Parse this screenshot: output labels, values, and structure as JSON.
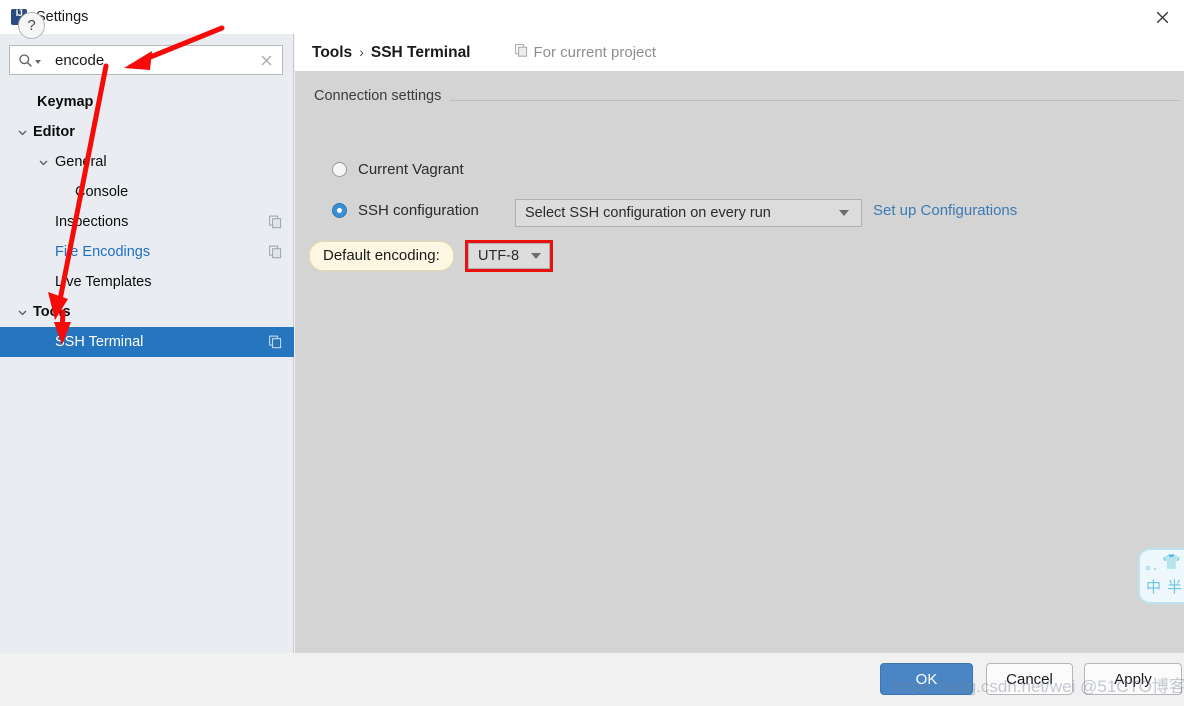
{
  "window": {
    "title": "Settings",
    "app_icon": "intellij-idea-icon",
    "close_label": "×"
  },
  "search": {
    "value": "encode",
    "placeholder": "",
    "icon": "search-icon",
    "clear_icon": "clear-icon"
  },
  "sidebar": {
    "items": [
      {
        "label": "Keymap",
        "indent": 37,
        "bold": true,
        "twisty": "",
        "link": false,
        "copy": false,
        "selected": false
      },
      {
        "label": "Editor",
        "indent": 33,
        "bold": true,
        "twisty": "down",
        "link": false,
        "copy": false,
        "selected": false
      },
      {
        "label": "General",
        "indent": 55,
        "bold": false,
        "twisty": "down",
        "link": false,
        "copy": false,
        "selected": false
      },
      {
        "label": "Console",
        "indent": 75,
        "bold": false,
        "twisty": "",
        "link": false,
        "copy": false,
        "selected": false
      },
      {
        "label": "Inspections",
        "indent": 55,
        "bold": false,
        "twisty": "",
        "link": false,
        "copy": true,
        "selected": false
      },
      {
        "label": "File Encodings",
        "indent": 55,
        "bold": false,
        "twisty": "",
        "link": true,
        "copy": true,
        "selected": false
      },
      {
        "label": "Live Templates",
        "indent": 55,
        "bold": false,
        "twisty": "",
        "link": false,
        "copy": false,
        "selected": false
      },
      {
        "label": "Tools",
        "indent": 33,
        "bold": true,
        "twisty": "down",
        "link": false,
        "copy": false,
        "selected": false
      },
      {
        "label": "SSH Terminal",
        "indent": 55,
        "bold": false,
        "twisty": "",
        "link": false,
        "copy": true,
        "selected": true
      }
    ]
  },
  "content": {
    "breadcrumb_parent": "Tools",
    "breadcrumb_sep": "›",
    "breadcrumb_current": "SSH Terminal",
    "project_scope": "For current project",
    "project_scope_icon": "copy-icon",
    "group_title": "Connection settings",
    "radio_vagrant": {
      "label": "Current Vagrant",
      "selected": false
    },
    "radio_ssh": {
      "label": "SSH configuration",
      "selected": true
    },
    "ssh_combo_value": "Select SSH configuration on every run",
    "setup_link": "Set up Configurations",
    "encoding_label": "Default encoding:",
    "encoding_value": "UTF-8"
  },
  "footer": {
    "help_label": "?",
    "ok_label": "OK",
    "cancel_label": "Cancel",
    "apply_label": "Apply"
  },
  "overlay": {
    "watermark": "https://blog.csdn.net/wei  @51CTO博客",
    "ime_char_mode": "中",
    "ime_width_mode": "半",
    "ime_shirt": "👕"
  },
  "colors": {
    "accent_selected": "#2675bf",
    "link": "#1f6fc4",
    "highlight_box": "#e8130e",
    "highlight_label_bg": "#fdf6e3",
    "annotation_arrow": "#f60b08",
    "ok_button": "#4a86c5"
  }
}
